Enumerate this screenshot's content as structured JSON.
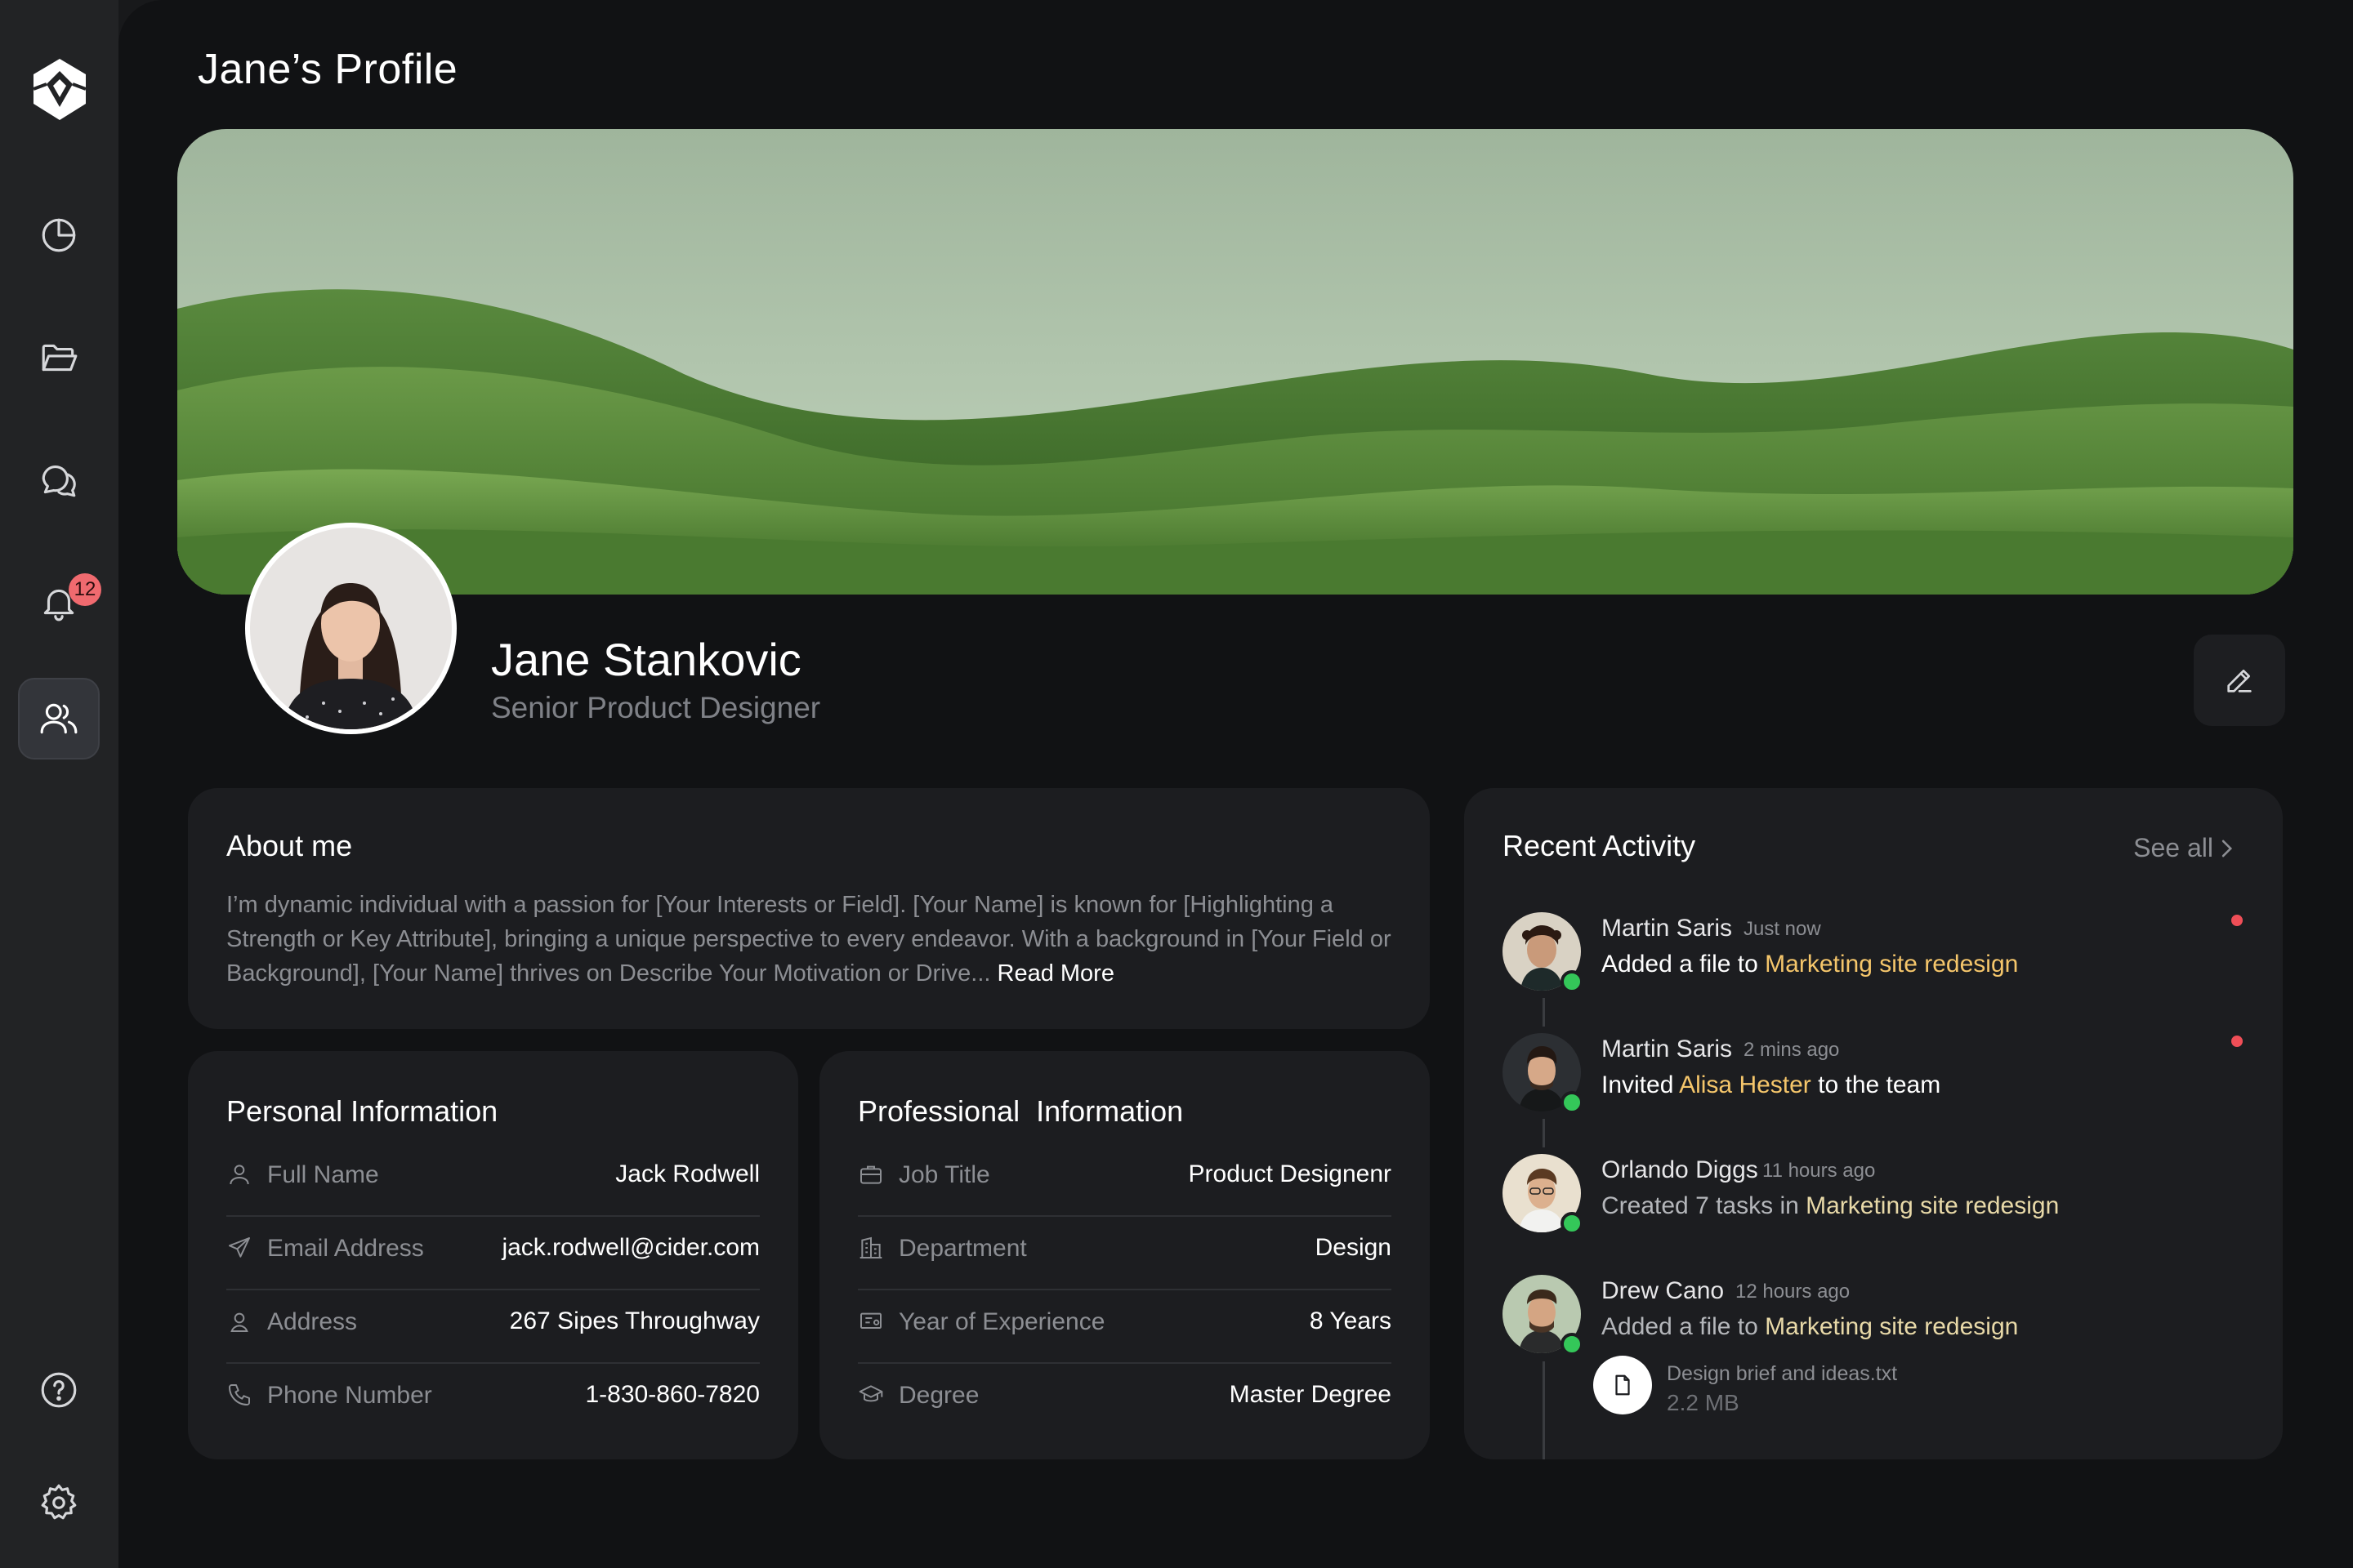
{
  "sidebar": {
    "logo": "logo-icon",
    "items": [
      {
        "icon": "pie-chart-icon",
        "name": "nav-analytics"
      },
      {
        "icon": "folder-icon",
        "name": "nav-files"
      },
      {
        "icon": "chat-icon",
        "name": "nav-messages"
      },
      {
        "icon": "bell-icon",
        "name": "nav-notifications",
        "badge": "12"
      },
      {
        "icon": "users-icon",
        "name": "nav-team",
        "active": true
      }
    ],
    "bottom_items": [
      {
        "icon": "help-icon",
        "name": "nav-help"
      },
      {
        "icon": "gear-icon",
        "name": "nav-settings"
      }
    ],
    "notification_badge": "12"
  },
  "header": {
    "title": "Jane’s Profile"
  },
  "profile": {
    "name": "Jane Stankovic",
    "role": "Senior Product Designer",
    "edit_icon": "pencil-icon"
  },
  "about": {
    "title": "About me",
    "text": "I’m dynamic individual with a passion for [Your Interests or Field]. [Your Name] is known for [Highlighting a Strength or Key Attribute], bringing a unique perspective to every endeavor. With a background in [Your Field or Background], [Your Name] thrives on Describe Your Motivation or Drive... ",
    "read_more": "Read More"
  },
  "personal": {
    "title": "Personal Information",
    "rows": [
      {
        "icon": "user-icon",
        "label": "Full Name",
        "value": "Jack Rodwell"
      },
      {
        "icon": "send-icon",
        "label": "Email Address",
        "value": "jack.rodwell@cider.com"
      },
      {
        "icon": "location-icon",
        "label": "Address",
        "value": "267 Sipes Throughway"
      },
      {
        "icon": "phone-icon",
        "label": "Phone Number",
        "value": "1-830-860-7820"
      }
    ]
  },
  "professional": {
    "title": "Professional  Information",
    "rows": [
      {
        "icon": "briefcase-icon",
        "label": "Job Title",
        "value": "Product Designenr"
      },
      {
        "icon": "building-icon",
        "label": "Department",
        "value": "Design"
      },
      {
        "icon": "certificate-icon",
        "label": "Year of Experience",
        "value": "8 Years"
      },
      {
        "icon": "graduation-cap-icon",
        "label": "Degree",
        "value": "Master Degree"
      }
    ]
  },
  "activity": {
    "title": "Recent Activity",
    "see_all": "See all",
    "items": [
      {
        "name": "Martin Saris",
        "time": "Just now",
        "pre": "Added a file to ",
        "highlight": "Marketing site redesign",
        "post": "",
        "unread": true
      },
      {
        "name": "Martin Saris",
        "time": "2 mins ago",
        "pre": "Invited ",
        "highlight": "Alisa Hester",
        "post": " to the team",
        "unread": true
      },
      {
        "name": "Orlando Diggs",
        "time": "11 hours ago",
        "pre": "Created 7 tasks in ",
        "highlight": "Marketing site redesign",
        "post": "",
        "unread": false
      },
      {
        "name": "Drew Cano",
        "time": "12 hours ago",
        "pre": "Added a file to ",
        "highlight": "Marketing site redesign",
        "post": "",
        "unread": false
      }
    ],
    "file": {
      "name": "Design brief and ideas.txt",
      "size": "2.2 MB",
      "icon": "file-icon"
    }
  },
  "colors": {
    "background": "#111214",
    "sidebar": "#222325",
    "card": "#1c1d20",
    "highlight": "#f5c66b",
    "online": "#34c759",
    "unread": "#ef4e57",
    "badge": "#f06a6f"
  }
}
